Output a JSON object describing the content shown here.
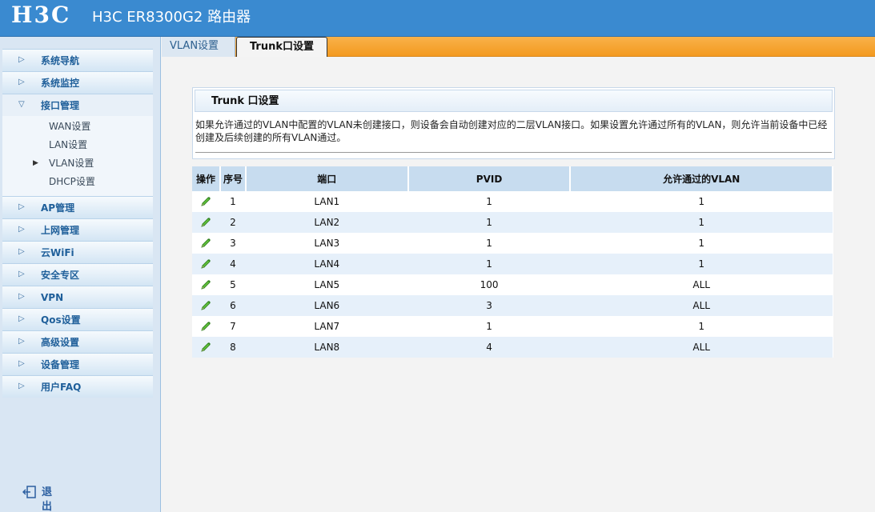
{
  "header": {
    "logo": "H3C",
    "title": "H3C ER8300G2 路由器"
  },
  "sidebar": {
    "items_top": [
      {
        "label": "系统导航"
      },
      {
        "label": "系统监控"
      },
      {
        "label": "接口管理",
        "open": true
      }
    ],
    "submenu": [
      {
        "label": "WAN设置"
      },
      {
        "label": "LAN设置"
      },
      {
        "label": "VLAN设置",
        "active": true
      },
      {
        "label": "DHCP设置"
      }
    ],
    "items_bottom": [
      {
        "label": "AP管理"
      },
      {
        "label": "上网管理"
      },
      {
        "label": "云WiFi"
      },
      {
        "label": "安全专区"
      },
      {
        "label": "VPN"
      },
      {
        "label": "Qos设置"
      },
      {
        "label": "高级设置"
      },
      {
        "label": "设备管理"
      },
      {
        "label": "用户FAQ"
      }
    ],
    "logout_label": "退出"
  },
  "tabs": [
    {
      "label": "VLAN设置",
      "active": false
    },
    {
      "label": "Trunk口设置",
      "active": true
    }
  ],
  "panel": {
    "title": "Trunk 口设置",
    "description": "如果允许通过的VLAN中配置的VLAN未创建接口，则设备会自动创建对应的二层VLAN接口。如果设置允许通过所有的VLAN，则允许当前设备中已经创建及后续创建的所有VLAN通过。"
  },
  "table": {
    "columns": [
      "操作",
      "序号",
      "端口",
      "PVID",
      "允许通过的VLAN"
    ],
    "rows": [
      {
        "seq": "1",
        "port": "LAN1",
        "pvid": "1",
        "vlan": "1"
      },
      {
        "seq": "2",
        "port": "LAN2",
        "pvid": "1",
        "vlan": "1"
      },
      {
        "seq": "3",
        "port": "LAN3",
        "pvid": "1",
        "vlan": "1"
      },
      {
        "seq": "4",
        "port": "LAN4",
        "pvid": "1",
        "vlan": "1"
      },
      {
        "seq": "5",
        "port": "LAN5",
        "pvid": "100",
        "vlan": "ALL"
      },
      {
        "seq": "6",
        "port": "LAN6",
        "pvid": "3",
        "vlan": "ALL"
      },
      {
        "seq": "7",
        "port": "LAN7",
        "pvid": "1",
        "vlan": "1"
      },
      {
        "seq": "8",
        "port": "LAN8",
        "pvid": "4",
        "vlan": "ALL"
      }
    ]
  },
  "colors": {
    "header_blue": "#3a8ad0",
    "tab_orange": "#f39a1f",
    "table_header": "#c7dcef",
    "row_alt": "#e6f0fa",
    "edit_icon_green": "#3c9a2a"
  }
}
